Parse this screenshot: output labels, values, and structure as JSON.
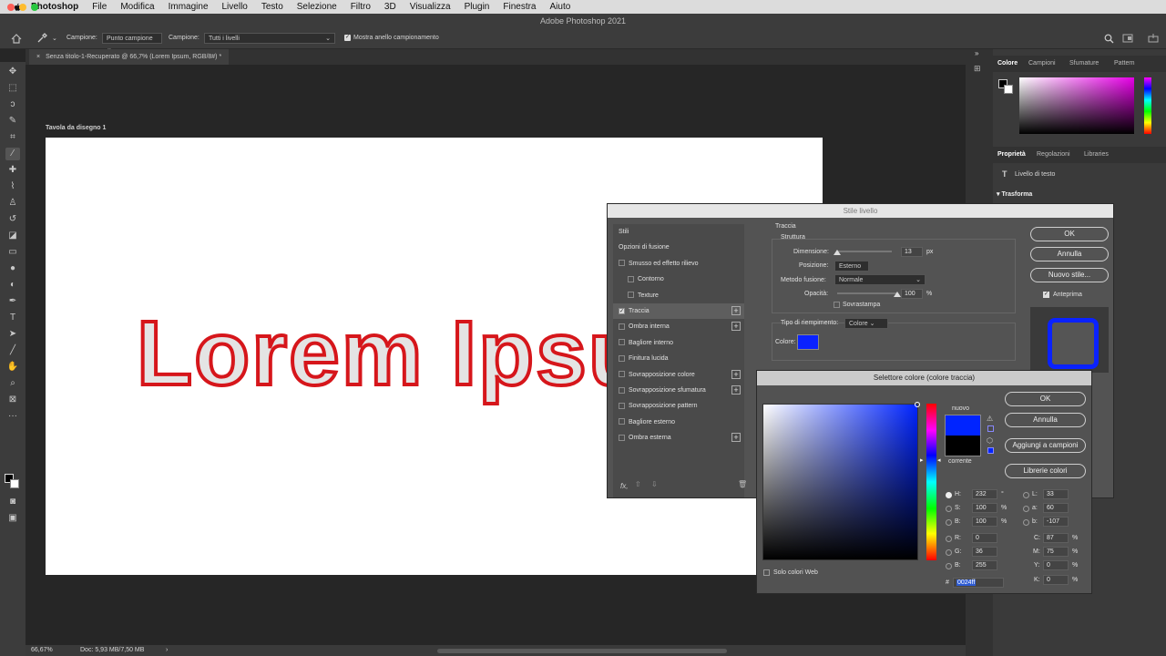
{
  "menubar": {
    "items": [
      "Photoshop",
      "File",
      "Modifica",
      "Immagine",
      "Livello",
      "Testo",
      "Selezione",
      "Filtro",
      "3D",
      "Visualizza",
      "Plugin",
      "Finestra",
      "Aiuto"
    ]
  },
  "window": {
    "title": "Adobe Photoshop 2021"
  },
  "options": {
    "sample_label": "Campione:",
    "sample_value": "Punto campione",
    "sample2_label": "Campione:",
    "sample2_value": "Tutti i livelli",
    "ring_label": "Mostra anello campionamento"
  },
  "document": {
    "tab_title": "Senza titolo-1-Recuperato @ 66,7% (Lorem Ipsum, RGB/8#) *",
    "artboard_label": "Tavola da disegno 1",
    "canvas_text": "Lorem Ipsum"
  },
  "status": {
    "zoom": "66,67%",
    "doc": "Doc: 5,93 MB/7,50 MB"
  },
  "right_panel": {
    "top_tabs": [
      "Colore",
      "Campioni",
      "Sfumature",
      "Pattern"
    ],
    "mid_tabs": [
      "Proprietà",
      "Regolazioni",
      "Libraries"
    ],
    "layer_type": "Livello di testo",
    "section": "Trasforma"
  },
  "layer_style": {
    "title": "Stile livello",
    "styles": [
      {
        "label": "Stili",
        "checkbox": false,
        "plus": false,
        "indent": false,
        "active": false
      },
      {
        "label": "Opzioni di fusione",
        "checkbox": false,
        "plus": false,
        "indent": false,
        "active": false
      },
      {
        "label": "Smusso ed effetto rilievo",
        "checkbox": true,
        "checked": false,
        "plus": false,
        "indent": false,
        "active": false
      },
      {
        "label": "Contorno",
        "checkbox": true,
        "checked": false,
        "plus": false,
        "indent": true,
        "active": false
      },
      {
        "label": "Texture",
        "checkbox": true,
        "checked": false,
        "plus": false,
        "indent": true,
        "active": false
      },
      {
        "label": "Traccia",
        "checkbox": true,
        "checked": true,
        "plus": true,
        "indent": false,
        "active": true
      },
      {
        "label": "Ombra interna",
        "checkbox": true,
        "checked": false,
        "plus": true,
        "indent": false,
        "active": false
      },
      {
        "label": "Bagliore interno",
        "checkbox": true,
        "checked": false,
        "plus": false,
        "indent": false,
        "active": false
      },
      {
        "label": "Finitura lucida",
        "checkbox": true,
        "checked": false,
        "plus": false,
        "indent": false,
        "active": false
      },
      {
        "label": "Sovrapposizione colore",
        "checkbox": true,
        "checked": false,
        "plus": true,
        "indent": false,
        "active": false
      },
      {
        "label": "Sovrapposizione sfumatura",
        "checkbox": true,
        "checked": false,
        "plus": true,
        "indent": false,
        "active": false
      },
      {
        "label": "Sovrapposizione pattern",
        "checkbox": true,
        "checked": false,
        "plus": false,
        "indent": false,
        "active": false
      },
      {
        "label": "Bagliore esterno",
        "checkbox": true,
        "checked": false,
        "plus": false,
        "indent": false,
        "active": false
      },
      {
        "label": "Ombra esterna",
        "checkbox": true,
        "checked": false,
        "plus": true,
        "indent": false,
        "active": false
      }
    ],
    "fx_label": "fx,",
    "section_title": "Traccia",
    "subsection": "Struttura",
    "size_label": "Dimensione:",
    "size_value": "13",
    "size_unit": "px",
    "size_fraction": 0.0,
    "position_label": "Posizione:",
    "position_value": "Esterno",
    "blend_label": "Metodo fusione:",
    "blend_value": "Normale",
    "opacity_label": "Opacità:",
    "opacity_value": "100",
    "opacity_unit": "%",
    "opacity_fraction": 1.0,
    "overprint_label": "Sovrastampa",
    "fill_type_label": "Tipo di riempimento:",
    "fill_type_value": "Colore",
    "color_label": "Colore:",
    "stroke_color": "#0a22ff",
    "buttons": {
      "ok": "OK",
      "cancel": "Annulla",
      "new_style": "Nuovo stile..."
    },
    "preview_label": "Anteprima"
  },
  "color_picker": {
    "title": "Selettore colore (colore traccia)",
    "new_label": "nuovo",
    "current_label": "corrente",
    "new_color": "#0024ff",
    "current_color": "#000000",
    "buttons": {
      "ok": "OK",
      "cancel": "Annulla",
      "add_swatch": "Aggiungi a campioni",
      "libraries": "Librerie colori"
    },
    "web_only_label": "Solo colori Web",
    "H": "232",
    "H_unit": "°",
    "S": "100",
    "S_unit": "%",
    "B": "100",
    "B_unit": "%",
    "R": "0",
    "G": "36",
    "Bl": "255",
    "L": "33",
    "a": "60",
    "b": "-107",
    "C": "87",
    "M": "75",
    "Y": "0",
    "K": "0",
    "pct": "%",
    "hex": "0024ff",
    "labels": {
      "H": "H:",
      "S": "S:",
      "B": "B:",
      "R": "R:",
      "G": "G:",
      "Bl": "B:",
      "L": "L:",
      "a": "a:",
      "b": "b:",
      "C": "C:",
      "M": "M:",
      "Y": "Y:",
      "K": "K:",
      "hash": "#"
    }
  }
}
